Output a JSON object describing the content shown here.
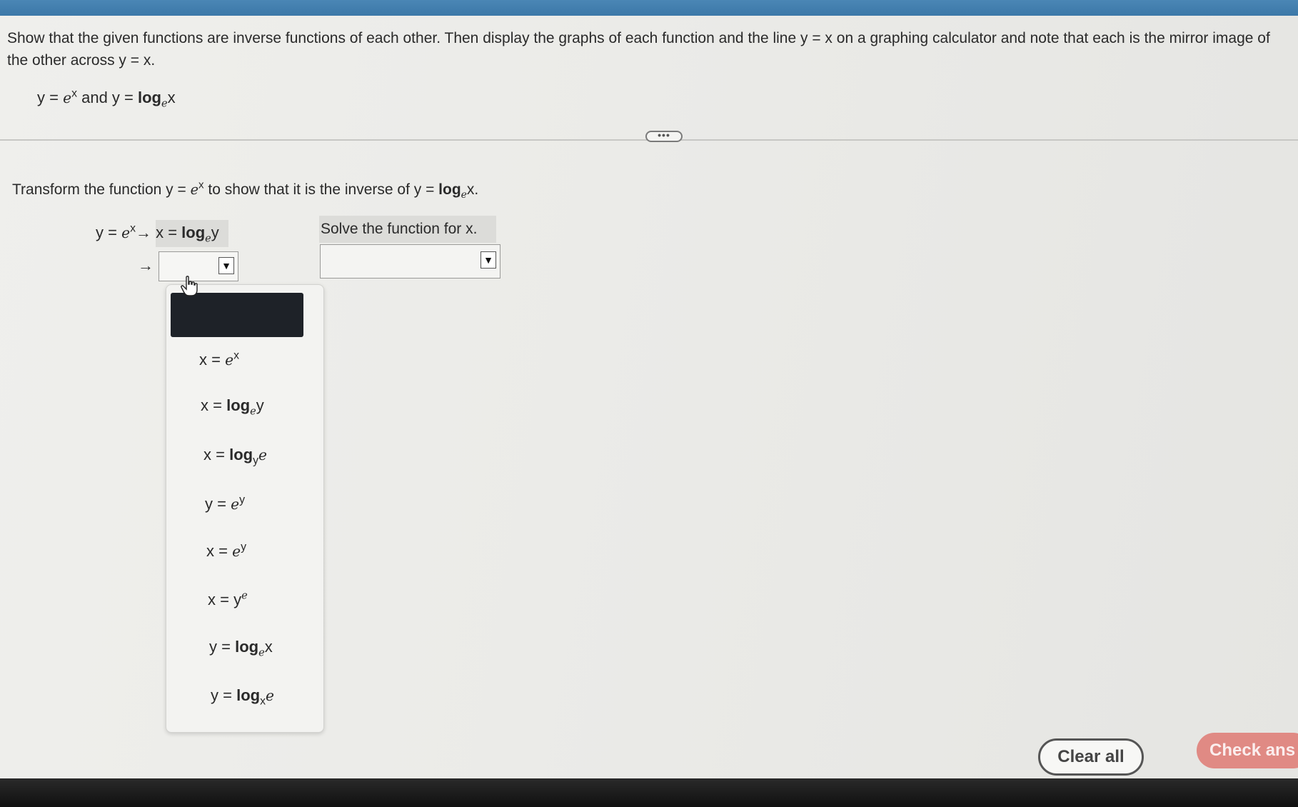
{
  "problem": {
    "statement": "Show that the given functions are inverse functions of each other. Then display the graphs of each function and the line y = x on a graphing calculator and note that each is the mirror image of the other across y = x.",
    "fn1_base": "y = ",
    "fn1_e": "e",
    "fn1_exp": "x",
    "and": " and ",
    "fn2_lhs": "y = ",
    "fn2_log": "log",
    "fn2_sub": "e",
    "fn2_arg": "x"
  },
  "more_button": "•••",
  "instruction": {
    "pre": "Transform the function y = ",
    "e": "e",
    "exp": "x",
    "mid": " to show that it is the inverse of y = ",
    "log": "log",
    "sub": "e",
    "post": "x."
  },
  "step1": {
    "lhs": "y = ",
    "e": "e",
    "exp": "x",
    "arrow": "→",
    "rhs_lhs": " x = ",
    "log": "log",
    "sub": "e",
    "arg": "y"
  },
  "step2": {
    "arrow": "→",
    "select_value": "",
    "dropdown_arrow": "▼"
  },
  "solve": {
    "label": "Solve the function for x.",
    "select_value": "",
    "dropdown_arrow": "▼"
  },
  "dropdown": {
    "selected_value": "",
    "options": [
      {
        "lhs": "x = ",
        "e": "e",
        "exp": "x"
      },
      {
        "lhs": "x = ",
        "log": "log",
        "sub": "e",
        "arg": "y"
      },
      {
        "lhs": "x = ",
        "log": "log",
        "sub": "y",
        "arg": "e"
      },
      {
        "lhs": "y = ",
        "e": "e",
        "exp": "y"
      },
      {
        "lhs": "x = ",
        "e": "e",
        "exp": "y"
      },
      {
        "lhs": "x = ",
        "base": "y",
        "exp": "e"
      },
      {
        "lhs": "y = ",
        "log": "log",
        "sub": "e",
        "arg": "x"
      },
      {
        "lhs": "y = ",
        "log": "log",
        "sub": "x",
        "arg": "e"
      }
    ]
  },
  "buttons": {
    "clear_all": "Clear all",
    "check_answer": "Check ans"
  },
  "colors": {
    "header_strip": "#3c78a8",
    "check_button": "#e08a84",
    "selected_option": "#1e2228"
  },
  "icons": {
    "cursor": "hand-pointer-icon",
    "dropdown": "triangle-down-icon"
  }
}
